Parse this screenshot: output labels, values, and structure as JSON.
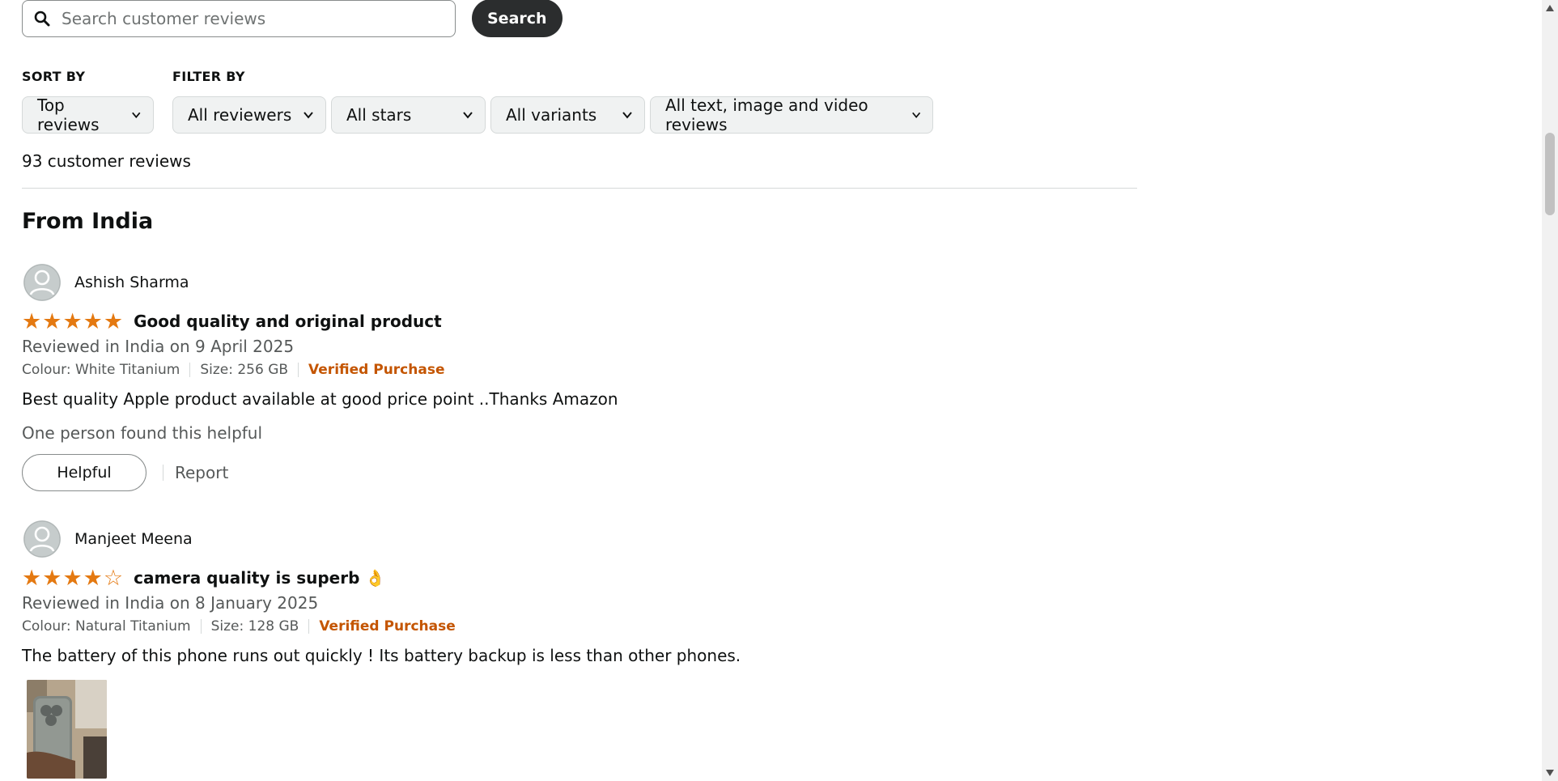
{
  "search": {
    "placeholder": "Search customer reviews",
    "button_label": "Search"
  },
  "sort": {
    "label": "SORT BY",
    "selected": "Top reviews"
  },
  "filter": {
    "label": "FILTER BY",
    "reviewers": "All reviewers",
    "stars": "All stars",
    "variants": "All variants",
    "media": "All text, image and video reviews"
  },
  "review_count": "93 customer reviews",
  "section_title": "From India",
  "reviews": [
    {
      "reviewer": "Ashish Sharma",
      "rating": 5,
      "title": "Good quality and original product",
      "date": "Reviewed in India on 9 April 2025",
      "colour": "Colour: White Titanium",
      "size": "Size: 256 GB",
      "verified": "Verified Purchase",
      "body": "Best quality Apple product available at good price point ..Thanks Amazon",
      "helpful_text": "One person found this helpful",
      "helpful_button": "Helpful",
      "report": "Report"
    },
    {
      "reviewer": "Manjeet Meena",
      "rating": 4,
      "title": "camera quality is superb 👌",
      "date": "Reviewed in India on 8 January 2025",
      "colour": "Colour: Natural Titanium",
      "size": "Size: 128 GB",
      "verified": "Verified Purchase",
      "body": "The battery of this phone runs out quickly ! Its battery backup is less than other phones."
    }
  ],
  "colors": {
    "star": "#e47911",
    "verified": "#c45500",
    "search_button": "#2b2d2e",
    "dropdown_bg": "#f0f2f2"
  }
}
